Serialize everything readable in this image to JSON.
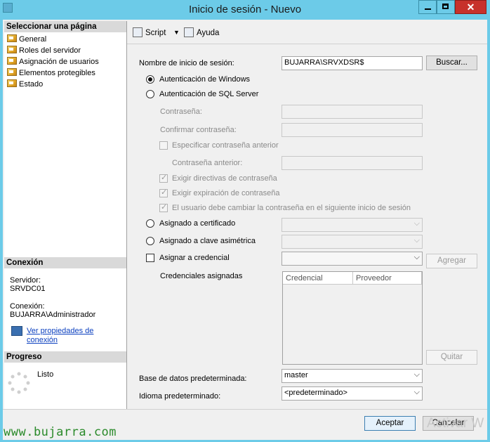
{
  "window": {
    "title": "Inicio de sesión - Nuevo",
    "close_glyph": "✕"
  },
  "left": {
    "select_page_header": "Seleccionar una página",
    "pages": [
      "General",
      "Roles del servidor",
      "Asignación de usuarios",
      "Elementos protegibles",
      "Estado"
    ],
    "connection_header": "Conexión",
    "server_label": "Servidor:",
    "server_value": "SRVDC01",
    "connection_label": "Conexión:",
    "connection_value": "BUJARRA\\Administrador",
    "view_props_line1": "Ver propiedades de",
    "view_props_line2": "conexión",
    "progress_header": "Progreso",
    "progress_status": "Listo"
  },
  "toolbar": {
    "script": "Script",
    "help": "Ayuda"
  },
  "form": {
    "login_name_label": "Nombre de inicio de sesión:",
    "login_name_value": "BUJARRA\\SRVXDSR$",
    "search_button": "Buscar...",
    "windows_auth": "Autenticación de Windows",
    "sql_auth": "Autenticación de SQL Server",
    "password_label": "Contraseña:",
    "confirm_password_label": "Confirmar contraseña:",
    "specify_old_password": "Especificar contraseña anterior",
    "old_password_label": "Contraseña anterior:",
    "enforce_policy": "Exigir directivas de contraseña",
    "enforce_expiration": "Exigir expiración de contraseña",
    "must_change": "El usuario debe cambiar la contraseña en el siguiente inicio de sesión",
    "mapped_certificate": "Asignado a certificado",
    "mapped_asym_key": "Asignado a clave asimétrica",
    "map_credential": "Asignar a credencial",
    "add_button": "Agregar",
    "mapped_credentials_label": "Credenciales asignadas",
    "col_credential": "Credencial",
    "col_provider": "Proveedor",
    "remove_button": "Quitar",
    "default_db_label": "Base de datos predeterminada:",
    "default_db_value": "master",
    "default_lang_label": "Idioma predeterminado:",
    "default_lang_value": "<predeterminado>"
  },
  "footer": {
    "ok": "Aceptar",
    "cancel": "Cancelar"
  },
  "overlay": {
    "watermark": "www.bujarra.com",
    "activate": "Activar W"
  },
  "colors": {
    "titlebar": "#6ccbe8",
    "close": "#c7312b",
    "link": "#0a3fbf",
    "watermark": "#2a8a2a"
  }
}
